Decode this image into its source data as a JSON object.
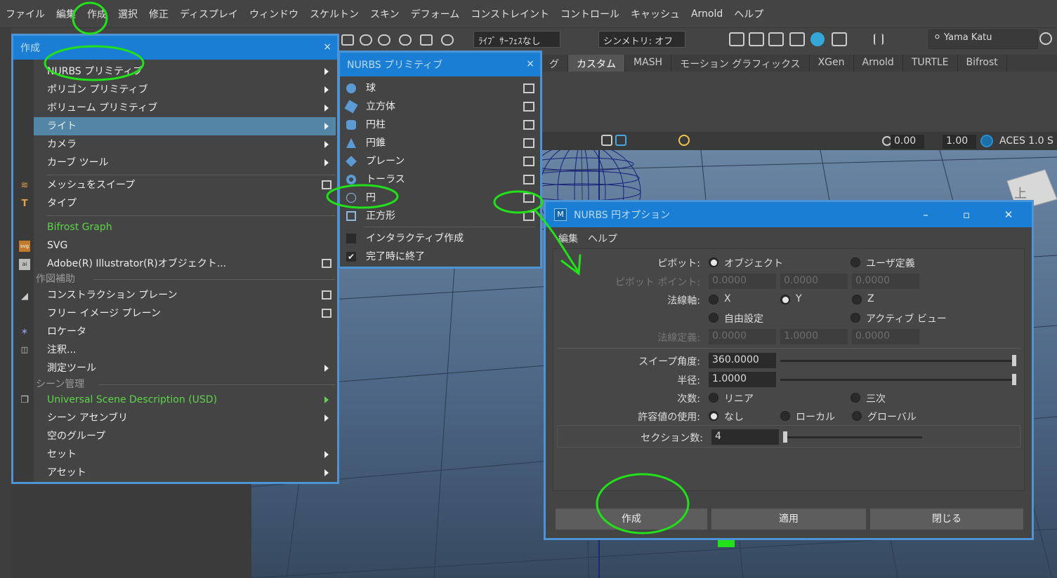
{
  "menubar": [
    "ファイル",
    "編集",
    "作成",
    "選択",
    "修正",
    "ディスプレイ",
    "ウィンドウ",
    "スケルトン",
    "スキン",
    "デフォーム",
    "コンストレイント",
    "コントロール",
    "キャッシュ",
    "Arnold",
    "ヘルプ"
  ],
  "toolbar": {
    "live_surface": "ﾗｲﾌﾞ ｻｰﾌｪｽなし",
    "symmetry": "シンメトリ: オフ",
    "user": "Yama Katu"
  },
  "shelf_tabs": [
    "グ",
    "カスタム",
    "MASH",
    "モーション グラフィックス",
    "XGen",
    "Arnold",
    "TURTLE",
    "Bifrost"
  ],
  "viewbar": {
    "val1": "0.00",
    "val2": "1.00",
    "aces": "ACES 1.0 S"
  },
  "create_menu": {
    "title": "作成",
    "items": [
      {
        "label": "NURBS プリミティブ"
      },
      {
        "label": "ポリゴン プリミティブ"
      },
      {
        "label": "ボリューム プリミティブ"
      },
      {
        "label": "ライト"
      },
      {
        "label": "カメラ"
      },
      {
        "label": "カーブ ツール"
      },
      {
        "label": "メッシュをスイープ"
      },
      {
        "label": "タイプ"
      },
      {
        "label": "Bifrost Graph"
      },
      {
        "label": "SVG"
      },
      {
        "label": "Adobe(R) Illustrator(R)オブジェクト..."
      },
      {
        "label": "コンストラクション プレーン"
      },
      {
        "label": "フリー イメージ プレーン"
      },
      {
        "label": "ロケータ"
      },
      {
        "label": "注釈..."
      },
      {
        "label": "測定ツール"
      },
      {
        "label": "Universal Scene Description (USD)"
      },
      {
        "label": "シーン アセンブリ"
      },
      {
        "label": "空のグループ"
      },
      {
        "label": "セット"
      },
      {
        "label": "アセット"
      }
    ],
    "section_drawing": "作図補助",
    "section_scene": "シーン管理"
  },
  "nurbs_menu": {
    "title": "NURBS プリミティブ",
    "items": [
      "球",
      "立方体",
      "円柱",
      "円錐",
      "プレーン",
      "トーラス",
      "円",
      "正方形"
    ],
    "interactive": "インタラクティブ作成",
    "exit_on_complete": "完了時に終了"
  },
  "options": {
    "title": "NURBS 円オプション",
    "menu_edit": "編集",
    "menu_help": "ヘルプ",
    "pivot_label": "ピボット:",
    "pivot_object": "オブジェクト",
    "pivot_user": "ユーザ定義",
    "pivot_point_label": "ピボット ポイント:",
    "pivot_point": [
      "0.0000",
      "0.0000",
      "0.0000"
    ],
    "normal_axis_label": "法線軸:",
    "axis_x": "X",
    "axis_y": "Y",
    "axis_z": "Z",
    "axis_free": "自由設定",
    "axis_active": "アクティブ ビュー",
    "normal_def_label": "法線定義:",
    "normal_def": [
      "0.0000",
      "1.0000",
      "0.0000"
    ],
    "sweep_label": "スイープ角度:",
    "sweep_value": "360.0000",
    "radius_label": "半径:",
    "radius_value": "1.0000",
    "degree_label": "次数:",
    "degree_linear": "リニア",
    "degree_cubic": "三次",
    "tolerance_label": "許容値の使用:",
    "tol_none": "なし",
    "tol_local": "ローカル",
    "tol_global": "グローバル",
    "sections_label": "セクション数:",
    "sections_value": "4",
    "btn_create": "作成",
    "btn_apply": "適用",
    "btn_close": "閉じる"
  },
  "colors": {
    "title_blue": "#1a7fd4",
    "highlight": "#5285a6",
    "annotation_green": "#22e01a",
    "bifrost_green": "#5ed44a"
  }
}
